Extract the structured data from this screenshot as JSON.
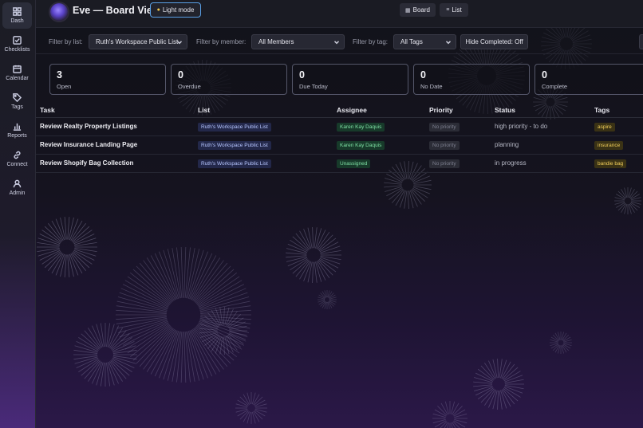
{
  "sidebar": {
    "items": [
      {
        "label": "Dash",
        "icon": "grid-icon",
        "active": true
      },
      {
        "label": "Checklists",
        "icon": "checkbox-icon"
      },
      {
        "label": "Calendar",
        "icon": "calendar-icon"
      },
      {
        "label": "Tags",
        "icon": "tag-icon"
      },
      {
        "label": "Reports",
        "icon": "bar-chart-icon"
      },
      {
        "label": "Connect",
        "icon": "link-icon"
      },
      {
        "label": "Admin",
        "icon": "user-icon"
      }
    ]
  },
  "header": {
    "title": "Eve — Board View",
    "theme_button": "Light mode",
    "views": [
      {
        "label": "Board",
        "icon": "board-icon"
      },
      {
        "label": "List",
        "icon": "list-icon"
      }
    ]
  },
  "filters": {
    "list_label": "Filter by list:",
    "list_value": "Ruth's Workspace Public List",
    "member_label": "Filter by member:",
    "member_value": "All Members",
    "tag_label": "Filter by tag:",
    "tag_value": "All Tags",
    "hide_completed": "Hide Completed: Off"
  },
  "stats": [
    {
      "value": "3",
      "label": "Open"
    },
    {
      "value": "0",
      "label": "Overdue"
    },
    {
      "value": "0",
      "label": "Due Today"
    },
    {
      "value": "0",
      "label": "No Date"
    },
    {
      "value": "0",
      "label": "Complete"
    }
  ],
  "table": {
    "columns": [
      "Task",
      "List",
      "Assignee",
      "Priority",
      "Status",
      "Tags"
    ],
    "rows": [
      {
        "task": "Review Realty Property Listings",
        "list": "Ruth's Workspace Public List",
        "assignee": "Karen Kay Daquis",
        "priority": "No priority",
        "status": "high priority - to do",
        "tag": "aspire"
      },
      {
        "task": "Review Insurance Landing Page",
        "list": "Ruth's Workspace Public List",
        "assignee": "Karen Kay Daquis",
        "priority": "No priority",
        "status": "planning",
        "tag": "insurance"
      },
      {
        "task": "Review Shopify Bag Collection",
        "list": "Ruth's Workspace Public List",
        "assignee": "Unassigned",
        "priority": "No priority",
        "status": "in progress",
        "tag": "bandie bag"
      }
    ]
  },
  "colors": {
    "accent_border": "#5aa0e6",
    "assignee_text": "#7fe0a4",
    "tag_text": "#f2cf5b",
    "list_text": "#b7c6ff"
  }
}
